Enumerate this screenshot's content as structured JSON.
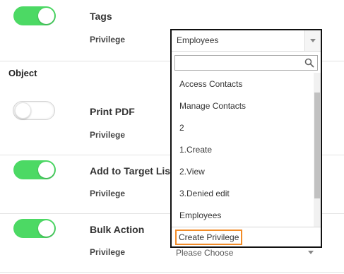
{
  "rows": [
    {
      "title": "Tags",
      "privilege_label": "Privilege",
      "enabled": true
    },
    {
      "title": "Print PDF",
      "privilege_label": "Privilege",
      "enabled": false
    },
    {
      "title": "Add to Target Lis",
      "privilege_label": "Privilege",
      "enabled": true
    },
    {
      "title": "Bulk Action",
      "privilege_label": "Privilege",
      "enabled": true
    }
  ],
  "section_object": "Object",
  "dropdown": {
    "selected": "Employees",
    "search_placeholder": "",
    "options": [
      "Access Contacts",
      "Manage Contacts",
      "2",
      "1.Create",
      "2.View",
      "3.Denied edit",
      "Employees"
    ],
    "footer_button": "Create Privilege"
  },
  "bulk_select_value": "Please Choose",
  "colors": {
    "toggle_on": "#4cd964",
    "highlight_border": "#f28c28"
  },
  "icons": {
    "search": "magnifier",
    "dropdown": "triangle-down"
  }
}
